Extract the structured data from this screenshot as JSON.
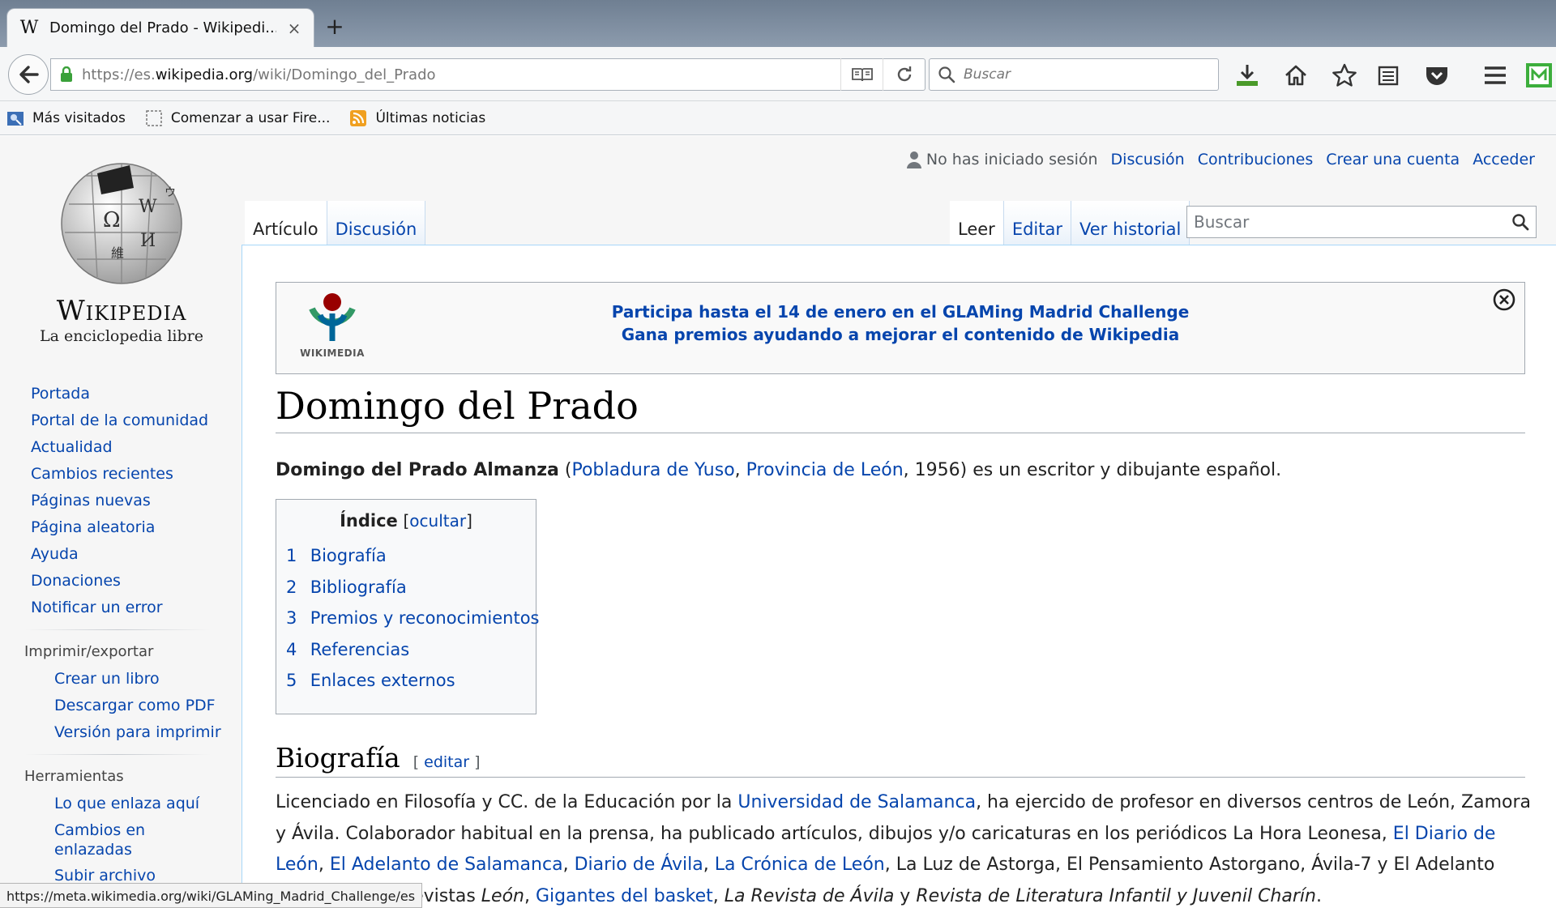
{
  "browser": {
    "tab_title": "Domingo del Prado - Wikipedi...",
    "tab_favicon": "W",
    "tab_close": "×",
    "new_tab": "+",
    "url_prefix": "https://es.",
    "url_domain": "wikipedia.org",
    "url_path": "/wiki/Domingo_del_Prado",
    "search_placeholder": "Buscar",
    "bookmarks": [
      "Más visitados",
      "Comenzar a usar Fire...",
      "Últimas noticias"
    ],
    "icons": [
      "back-arrow-icon",
      "lock-icon",
      "reader-view-icon",
      "reload-icon",
      "search-icon",
      "download-icon",
      "home-icon",
      "star-icon",
      "reading-list-icon",
      "pocket-icon",
      "menu-icon",
      "extension-icon"
    ]
  },
  "wiki": {
    "wordmark": "Wikipedia",
    "tagline": "La enciclopedia libre",
    "personal": {
      "status": "No has iniciado sesión",
      "links": [
        "Discusión",
        "Contribuciones",
        "Crear una cuenta",
        "Acceder"
      ]
    },
    "tabs_left": [
      "Artículo",
      "Discusión"
    ],
    "tabs_right": [
      "Leer",
      "Editar",
      "Ver historial"
    ],
    "search_placeholder": "Buscar",
    "sidebar": {
      "main": [
        "Portada",
        "Portal de la comunidad",
        "Actualidad",
        "Cambios recientes",
        "Páginas nuevas",
        "Página aleatoria",
        "Ayuda",
        "Donaciones",
        "Notificar un error"
      ],
      "print_heading": "Imprimir/exportar",
      "print": [
        "Crear un libro",
        "Descargar como PDF",
        "Versión para imprimir"
      ],
      "tools_heading": "Herramientas",
      "tools": [
        "Lo que enlaza aquí",
        "Cambios en enlazadas",
        "Subir archivo"
      ]
    },
    "banner": {
      "logo_text": "WIKIMEDIA",
      "line1": "Participa hasta el 14 de enero en el GLAMing Madrid Challenge",
      "line2": "Gana premios ayudando a mejorar el contenido de Wikipedia"
    },
    "title": "Domingo del Prado",
    "intro": {
      "bold": "Domingo del Prado Almanza",
      "open": " (",
      "link1": "Pobladura de Yuso",
      "comma": ", ",
      "link2": "Provincia de León",
      "rest": ", 1956) es un escritor y dibujante español."
    },
    "toc": {
      "title": "Índice",
      "toggle": "ocultar",
      "items": [
        {
          "num": "1",
          "label": "Biografía"
        },
        {
          "num": "2",
          "label": "Bibliografía"
        },
        {
          "num": "3",
          "label": "Premios y reconocimientos"
        },
        {
          "num": "4",
          "label": "Referencias"
        },
        {
          "num": "5",
          "label": "Enlaces externos"
        }
      ]
    },
    "section": {
      "heading": "Biografía",
      "edit": "editar"
    },
    "paragraph": {
      "t1": "Licenciado en Filosofía y CC. de la Educación por la ",
      "l1": "Universidad de Salamanca",
      "t2": ", ha ejercido de profesor en diversos centros de León, Zamora y Ávila. Colaborador habitual en la prensa, ha publicado artículos, dibujos y/o caricaturas en los periódicos La Hora Leonesa, ",
      "l2": "El Diario de León",
      "t3": ", ",
      "l3": "El Adelanto de Salamanca",
      "t4": ", ",
      "l4": "Diario de Ávila",
      "t5": ", ",
      "l5": "La Crónica de León",
      "t6": ", La Luz de Astorga, El Pensamiento Astorgano, Ávila-7 y El Adelanto Bañezano, las revistas ",
      "i1": "León",
      "t7": ", ",
      "l6": "Gigantes del basket",
      "t8": ", ",
      "i2": "La Revista de Ávila",
      "t9": " y ",
      "i3": "Revista de Literatura Infantil y Juvenil Charín",
      "t10": "."
    },
    "status_url": "https://meta.wikimedia.org/wiki/GLAMing_Madrid_Challenge/es"
  }
}
